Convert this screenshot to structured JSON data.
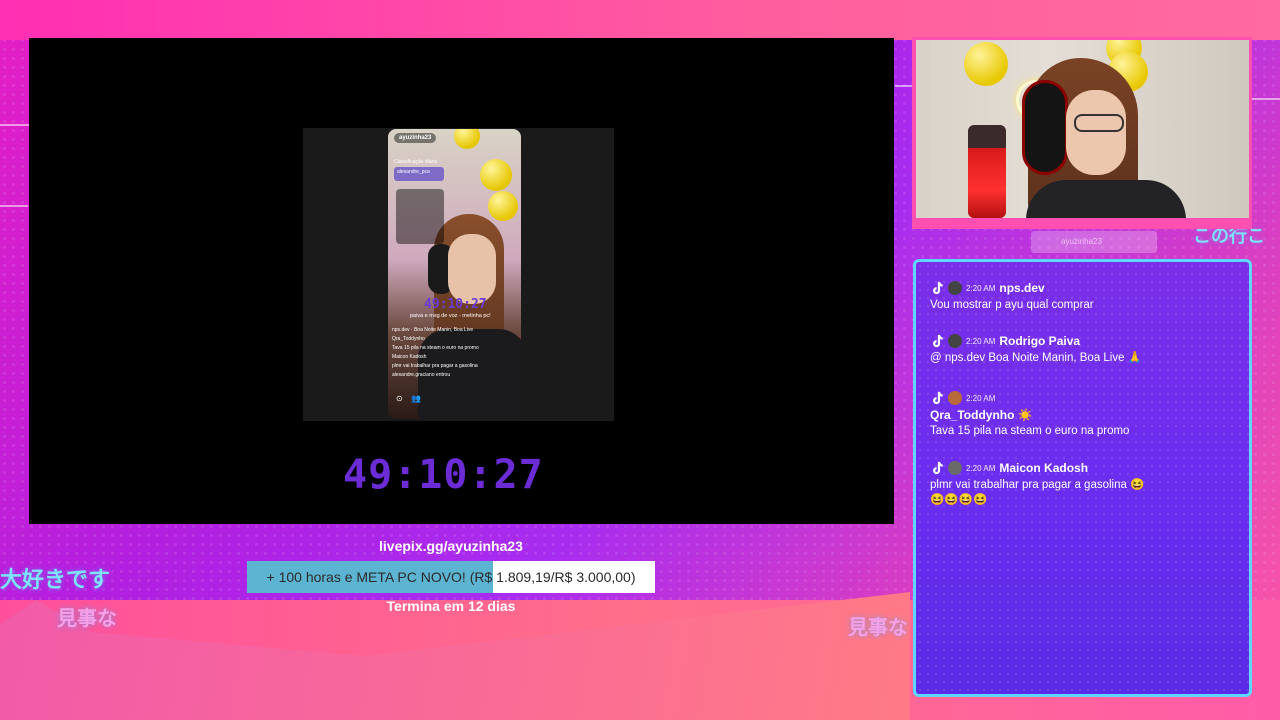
{
  "stream": {
    "timer": "49:10:27",
    "livepix_url": "livepix.gg/ayuzinha23",
    "goal": {
      "text": "+ 100 horas e META PC NOVO! (R$ 1.809,19/R$ 3.000,00)",
      "progress": 0.603
    },
    "goal_end": "Termina em 12 dias"
  },
  "phone": {
    "username": "ayuzinha23",
    "rank": "Classificação diária",
    "pill": "alexandre_pca",
    "timer": "49:10:27",
    "goal": "paiva e msg de voz - metinha pc!",
    "chat": [
      "nps.dev · Boa Noite Manin, Boa Live",
      "Qra_Toddynho",
      "Tava 15 pila na steam o euro na promo",
      "Maicon Kadosh",
      "plmr vai trabalhar pra pagar a gasolina",
      "alexandre.graciano entrou"
    ]
  },
  "decor": {
    "jp_left": "大好きです",
    "jp_left2": "見事な",
    "jp_right": "見事な",
    "jp_top_right": "この行こ",
    "cam_tag": "ayuzinha23"
  },
  "chat": {
    "messages": [
      {
        "time": "2:20 AM",
        "user": "nps.dev",
        "text": "Vou mostrar p ayu qual comprar"
      },
      {
        "time": "2:20 AM",
        "user": "Rodrigo Paiva",
        "text": "@ nps.dev Boa Noite Manin, Boa Live 🙏"
      },
      {
        "time": "2:20 AM",
        "user": "Qra_Toddynho ☀️",
        "text": "Tava 15 pila na steam o euro na promo"
      },
      {
        "time": "2:20 AM",
        "user": "Maicon Kadosh",
        "text": "plmr vai trabalhar pra pagar a gasolina 😆😆😆😆😆"
      }
    ]
  },
  "colors": {
    "accent": "#6b2cd6",
    "chat_border": "#5fd8ff",
    "goal_fill": "#5cb4d2"
  }
}
